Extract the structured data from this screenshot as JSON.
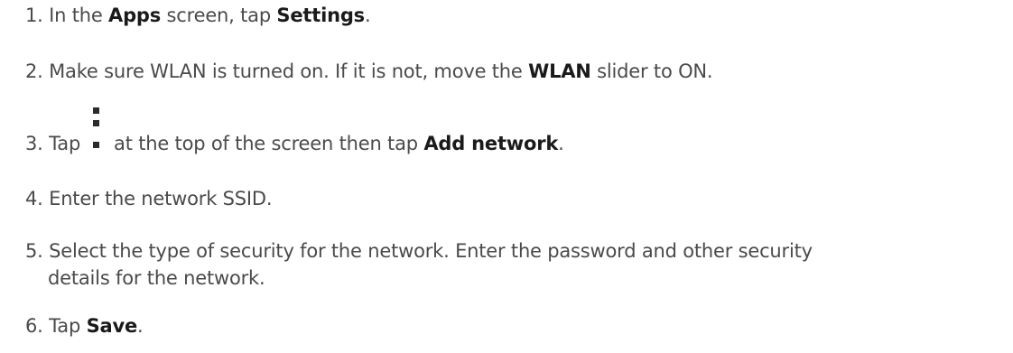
{
  "steps": [
    {
      "num": "1.",
      "parts": [
        "In the ",
        "Apps",
        " screen, tap ",
        "Settings",
        "."
      ]
    },
    {
      "num": "2.",
      "parts": [
        "Make sure WLAN is turned on. If it is not, move the ",
        "WLAN",
        " slider to ON."
      ]
    },
    {
      "num": "3.",
      "parts": [
        "Tap ",
        " at the top of the screen then tap ",
        "Add network",
        "."
      ],
      "icon": "more-vert-icon"
    },
    {
      "num": "4.",
      "parts": [
        "Enter the network SSID."
      ]
    },
    {
      "num": "5.",
      "parts": [
        "Select the type of security for the network. Enter the password and other security",
        "details for the network."
      ]
    },
    {
      "num": "6.",
      "parts": [
        "Tap ",
        "Save",
        "."
      ]
    }
  ]
}
